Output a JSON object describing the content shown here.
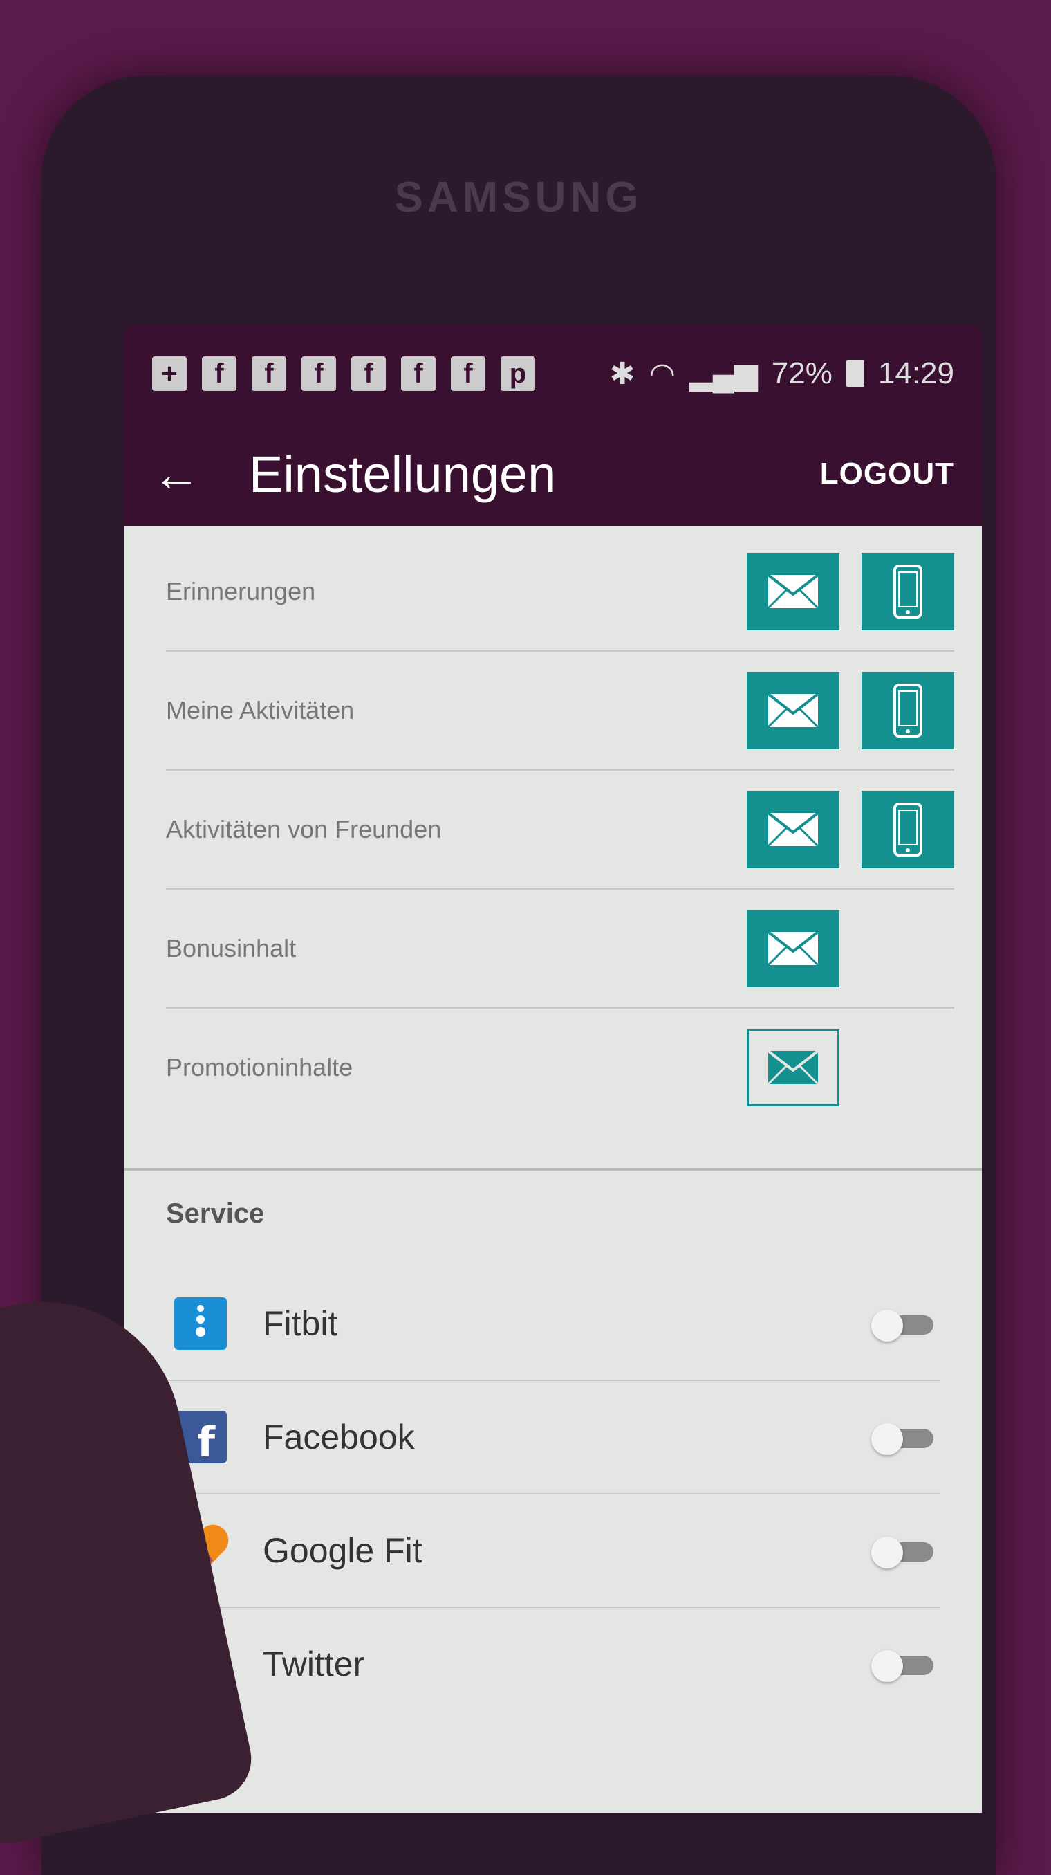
{
  "device": {
    "brand": "SAMSUNG"
  },
  "statusbar": {
    "notification_icons": [
      "+",
      "f",
      "f",
      "f",
      "f",
      "f",
      "f",
      "p"
    ],
    "battery": "72%",
    "time": "14:29"
  },
  "appbar": {
    "back": "←",
    "title": "Einstellungen",
    "logout": "LOGOUT"
  },
  "notifications": [
    {
      "label": "Erinnerungen",
      "email": true,
      "push": true
    },
    {
      "label": "Meine Aktivitäten",
      "email": true,
      "push": true
    },
    {
      "label": "Aktivitäten von Freunden",
      "email": true,
      "push": true
    },
    {
      "label": "Bonusinhalt",
      "email": true,
      "push": null
    },
    {
      "label": "Promotioninhalte",
      "email": false,
      "push": null
    }
  ],
  "service": {
    "title": "Service",
    "items": [
      {
        "name": "Fitbit",
        "icon": "fitbit-icon",
        "enabled": false
      },
      {
        "name": "Facebook",
        "icon": "facebook-icon",
        "enabled": false
      },
      {
        "name": "Google Fit",
        "icon": "google-fit-icon",
        "enabled": false
      },
      {
        "name": "Twitter",
        "icon": "twitter-icon",
        "enabled": false
      }
    ]
  },
  "colors": {
    "accent": "#13908f",
    "appbar": "#3a1030",
    "panel": "#e4e6e3"
  }
}
